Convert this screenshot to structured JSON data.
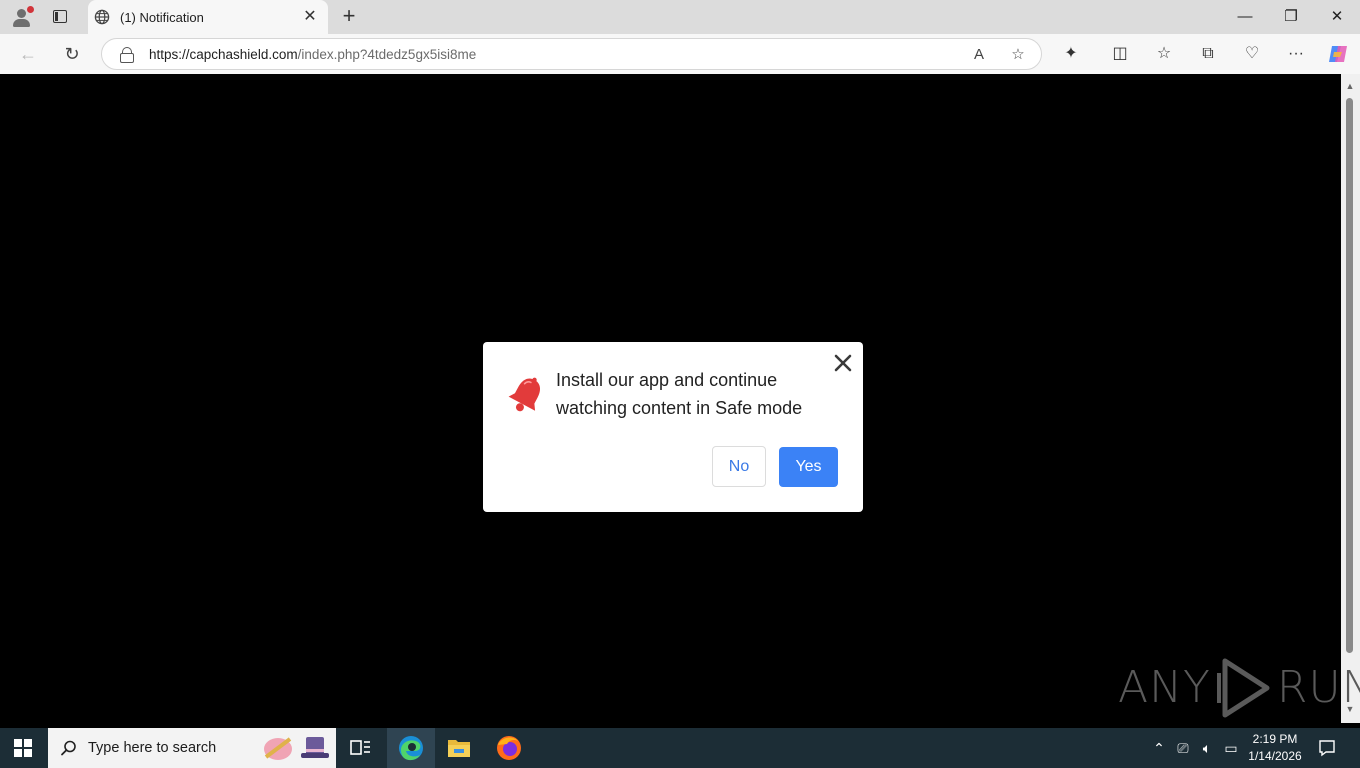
{
  "browser": {
    "tab": {
      "title": "(1) Notification",
      "close": "✕"
    },
    "new_tab": "+",
    "window": {
      "minimize": "—",
      "restore": "❐",
      "close": "✕"
    },
    "nav": {
      "back": "←",
      "reload": "↻"
    },
    "address": {
      "host": "https://capchashield.com",
      "path": "/index.php?4tdedz5gx5isi8me"
    },
    "omni_icons": {
      "read_aloud": "A",
      "favorite": "☆"
    },
    "toolbar": {
      "extensions": "✦",
      "split": "◫",
      "favorites": "☆",
      "collections": "⧉",
      "performance": "♡",
      "more": "···"
    }
  },
  "dialog": {
    "message": "Install our app and continue watching content in Safe mode",
    "no_label": "No",
    "yes_label": "Yes",
    "accent": "#3b82f6",
    "bell_color": "#e23b3b"
  },
  "watermark": {
    "left": "ANY",
    "right": "RUN"
  },
  "taskbar": {
    "search_placeholder": "Type here to search",
    "time": "2:19 PM",
    "date": "1/14/2026"
  }
}
